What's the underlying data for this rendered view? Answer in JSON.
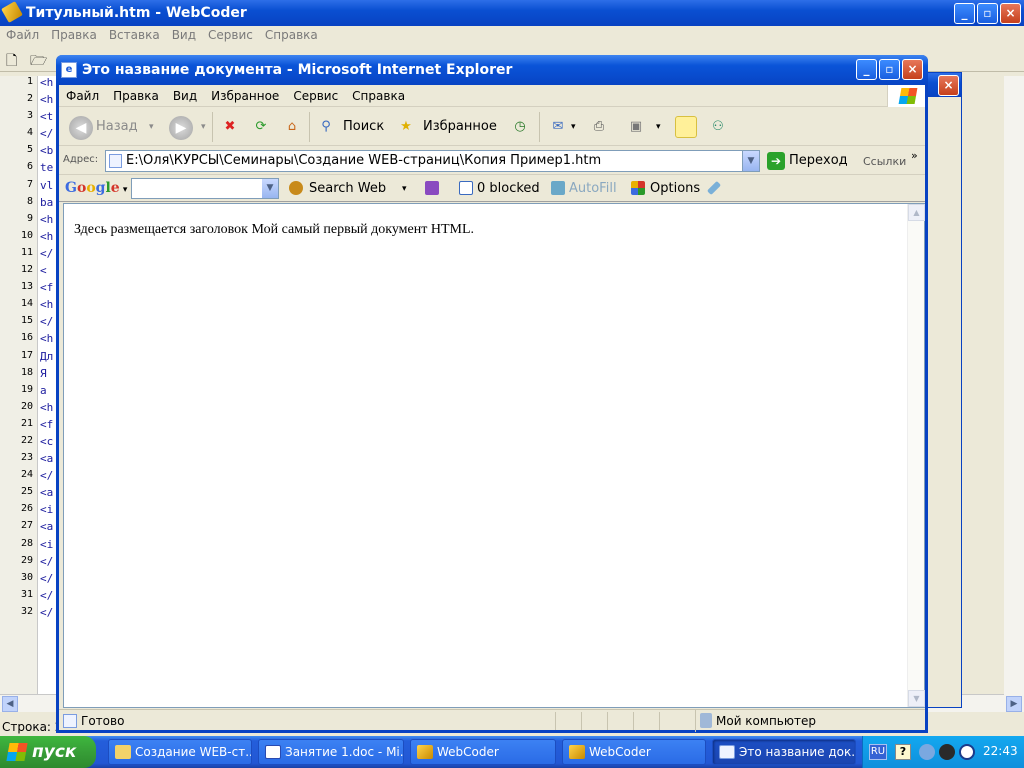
{
  "webcoder": {
    "title": "Титульный.htm - WebCoder",
    "menu": [
      "Файл",
      "Правка",
      "Вставка",
      "Вид",
      "Сервис",
      "Справка"
    ],
    "line_numbers": [
      "1",
      "2",
      "3",
      "4",
      "5",
      "6",
      "7",
      "8",
      "9",
      "10",
      "11",
      "12",
      "13",
      "14",
      "15",
      "16",
      "17",
      "18",
      "19",
      "20",
      "21",
      "22",
      "23",
      "24",
      "25",
      "26",
      "27",
      "28",
      "29",
      "30",
      "31",
      "32"
    ],
    "code_fragments": [
      "<h",
      "<h",
      "<t",
      "</",
      "<b",
      "te",
      "vl",
      "ba",
      "<h",
      "<h",
      "</",
      "<",
      "<f",
      "<h",
      "</",
      "<h",
      "Дл",
      "Я",
      "a",
      "<h",
      "<f",
      "<c",
      "<a",
      "</",
      "<a",
      "<i",
      "<a",
      "<i",
      "</",
      "</",
      "</",
      "</"
    ],
    "status": "Строка: 2"
  },
  "ie": {
    "title": "Это название документа - Microsoft Internet Explorer",
    "menu": [
      "Файл",
      "Правка",
      "Вид",
      "Избранное",
      "Сервис",
      "Справка"
    ],
    "back_label": "Назад",
    "search_label": "Поиск",
    "favorites_label": "Избранное",
    "address_label": "Адрес:",
    "address_value": "E:\\Оля\\КУРСЫ\\Семинары\\Создание WEB-страниц\\Копия Пример1.htm",
    "go_label": "Переход",
    "links_label": "Ссылки",
    "more_label": "»",
    "google": {
      "logo": "Google",
      "search_web": "Search Web",
      "blocked": "0 blocked",
      "autofill": "AutoFill",
      "options": "Options"
    },
    "content_text": "Здесь размещается заголовок Мой самый первый документ HTML.",
    "status_ready": "Готово",
    "status_zone": "Мой компьютер"
  },
  "taskbar": {
    "start_label": "пуск",
    "tasks": [
      "Создание WEB-ст...",
      "Занятие 1.doc - Mi...",
      "WebCoder",
      "WebCoder",
      "Это название док..."
    ],
    "lang": "RU",
    "time": "22:43"
  }
}
